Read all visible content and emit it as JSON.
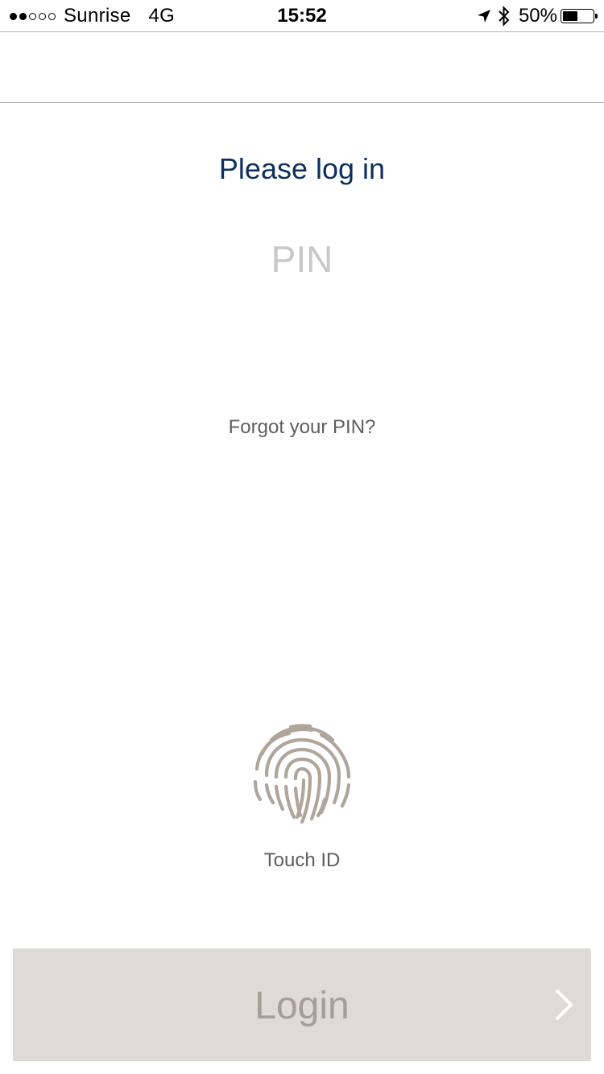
{
  "status_bar": {
    "signal_strength": "2 of 5",
    "carrier": "Sunrise",
    "network": "4G",
    "time": "15:52",
    "location_icon": "location-arrow-icon",
    "bluetooth_icon": "bluetooth-icon",
    "battery_percent": "50%",
    "battery_level": 0.5
  },
  "main": {
    "title": "Please log in",
    "pin_placeholder": "PIN",
    "forgot_pin": "Forgot your PIN?",
    "touch_id_label": "Touch ID",
    "touch_id_icon": "fingerprint-icon"
  },
  "footer": {
    "login_label": "Login",
    "chevron_icon": "chevron-right-icon"
  },
  "colors": {
    "title": "#0e2f5b",
    "fingerprint": "#b0a59b",
    "login_background": "#dedad6",
    "login_text": "#a69d95"
  }
}
